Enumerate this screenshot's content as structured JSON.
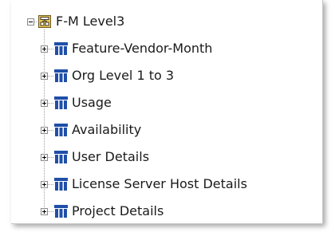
{
  "tree": {
    "root": {
      "label": "F-M Level3",
      "icon": "hierarchy-folder-icon",
      "expanded": true
    },
    "children": [
      {
        "label": "Feature-Vendor-Month",
        "icon": "cube-icon",
        "expanded": false
      },
      {
        "label": "Org Level 1 to 3",
        "icon": "cube-icon",
        "expanded": false
      },
      {
        "label": "Usage",
        "icon": "cube-icon",
        "expanded": false
      },
      {
        "label": "Availability",
        "icon": "cube-icon",
        "expanded": false
      },
      {
        "label": "User Details",
        "icon": "cube-icon",
        "expanded": false
      },
      {
        "label": "License Server Host Details",
        "icon": "cube-icon",
        "expanded": false
      },
      {
        "label": "Project Details",
        "icon": "cube-icon",
        "expanded": false
      }
    ]
  },
  "colors": {
    "icon_blue": "#1f4fa8",
    "icon_yellow": "#f2c94c",
    "line": "#a0a0a0"
  }
}
